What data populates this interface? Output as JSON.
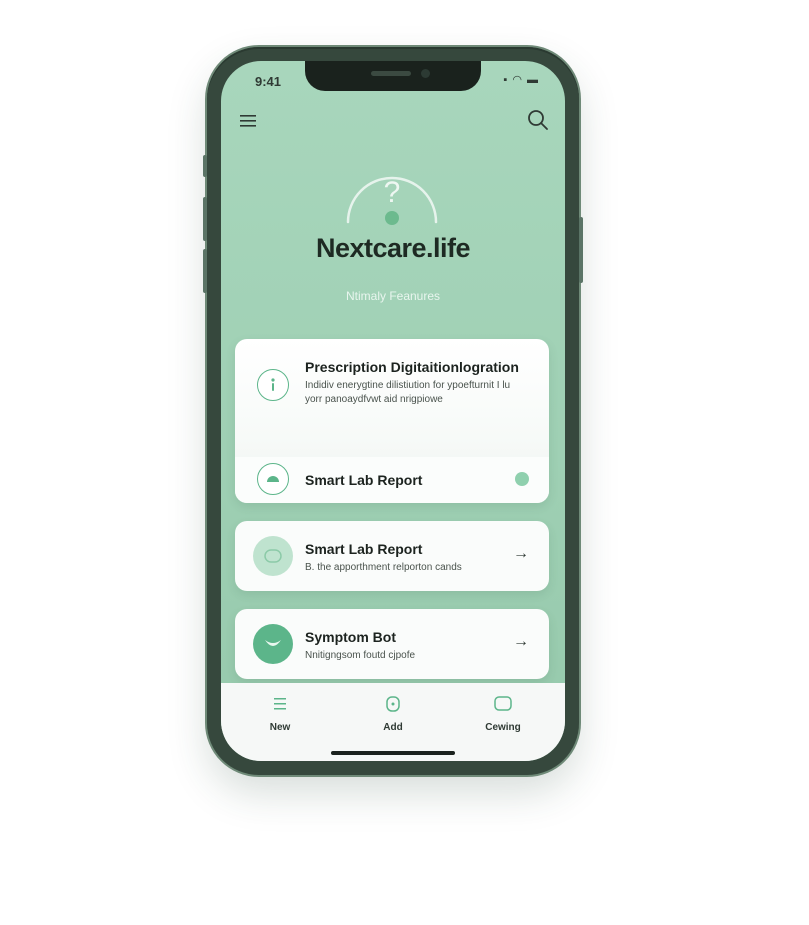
{
  "status_bar": {
    "time": "9:41",
    "icons": "▪ ◠ ▬"
  },
  "header": {
    "menu_icon": "hamburger-menu-icon",
    "search_icon": "search-icon"
  },
  "hero": {
    "logo_glyph": "?",
    "title": "Nextcare.life",
    "subtitle": "Ntimaly Feanures"
  },
  "cards": [
    {
      "title": "Prescription Digitaitionlogration",
      "description": "Indidiv enerygtine dilistiution for ypoefturnit I lu yorr panoaydfvwt aid nrigpiowe",
      "icon": "info-icon",
      "sub_item": {
        "title": "Smart Lab Report",
        "icon": "lab-icon"
      }
    },
    {
      "title": "Smart Lab Report",
      "description": "B. the apporthment relporton cands",
      "icon": "lab-report-icon",
      "arrow": "→"
    },
    {
      "title": "Symptom Bot",
      "description": "Nnitigngsom foutd cjpofe",
      "icon": "symptom-bot-icon",
      "arrow": "→"
    }
  ],
  "tab_bar": [
    {
      "label": "New",
      "icon": "list-icon"
    },
    {
      "label": "Add",
      "icon": "add-icon"
    },
    {
      "label": "Cewing",
      "icon": "chat-icon"
    }
  ],
  "colors": {
    "accent": "#5cb58a",
    "screen_bg": "#a3d3b8",
    "frame": "#36483d"
  }
}
